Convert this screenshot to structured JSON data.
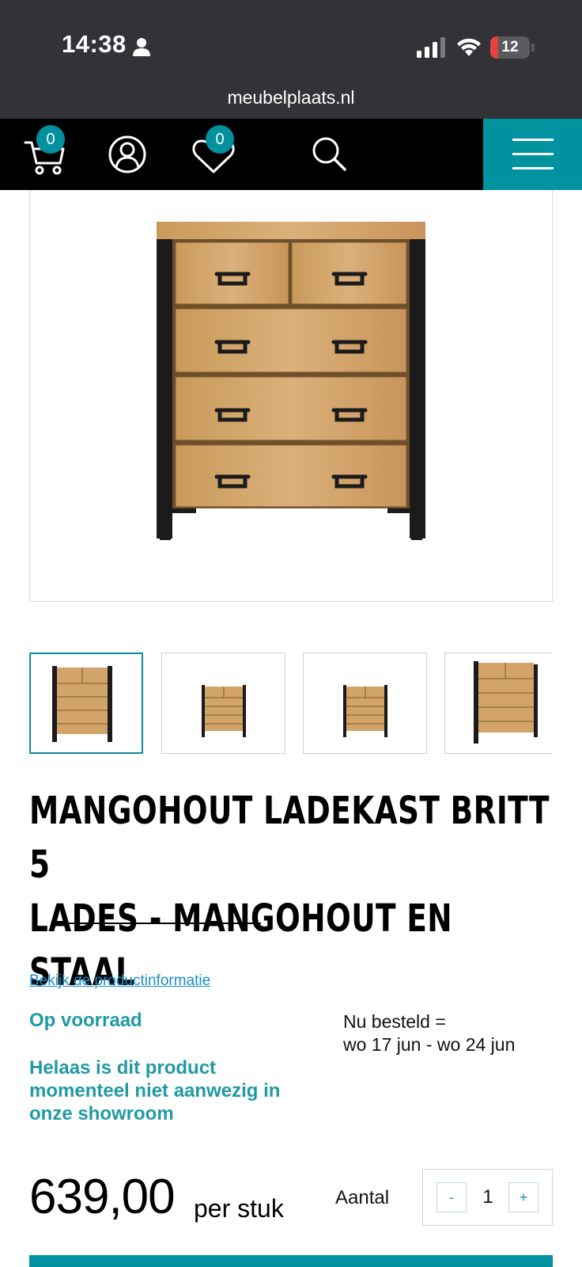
{
  "status_bar": {
    "time": "14:38",
    "battery_level": "12",
    "icons": [
      "person-icon",
      "signal-icon",
      "wifi-icon",
      "battery-icon"
    ]
  },
  "browser": {
    "url": "meubelplaats.nl"
  },
  "nav": {
    "cart_count": "0",
    "wishlist_count": "0",
    "icons": [
      "cart-icon",
      "account-icon",
      "heart-icon",
      "search-icon",
      "menu-icon"
    ],
    "accent_color": "#00929f"
  },
  "product": {
    "title_line1": "MANGOHOUT LADEKAST BRITT 5",
    "title_line2": "LADES - MANGOHOUT EN STAAL",
    "info_link": "Bekijk de productinformatie",
    "stock_status": "Op voorraad",
    "showroom_notice": "Helaas is dit product momenteel niet aanwezig in onze showroom",
    "delivery_line1": "Nu besteld =",
    "delivery_line2": "wo 17 jun - wo 24 jun",
    "price": "639,00",
    "price_unit": "per stuk",
    "quantity_label": "Aantal",
    "quantity": "1",
    "qty_minus": "-",
    "qty_plus": "+",
    "thumbnail_count": 4,
    "active_thumbnail": 1
  },
  "colors": {
    "teal": "#1f9aa4",
    "link_blue": "#1a90c8",
    "dark_bar": "#323336"
  }
}
